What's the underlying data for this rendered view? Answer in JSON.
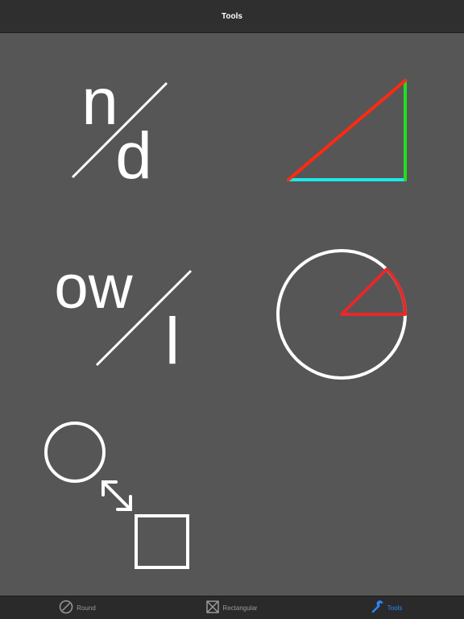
{
  "navbar": {
    "title": "Tools"
  },
  "tools": {
    "fraction": {
      "numerator": "n",
      "denominator": "d"
    },
    "length_ratio": {
      "numerator": "ow",
      "denominator": "l"
    }
  },
  "tabs": [
    {
      "label": "Round",
      "icon": "round-icon",
      "active": false
    },
    {
      "label": "Rectangular",
      "icon": "rectangular-icon",
      "active": false
    },
    {
      "label": "Tools",
      "icon": "wrench-icon",
      "active": true
    }
  ],
  "colors": {
    "background": "#565656",
    "navbar": "#2f2f2f",
    "tabbar": "#2a2a2a",
    "accent_blue": "#2d86ff",
    "hypotenuse_red": "#ff2a10",
    "vertical_green": "#1fe01f",
    "base_cyan": "#1fe8e8",
    "sector_red": "#e8282a"
  }
}
